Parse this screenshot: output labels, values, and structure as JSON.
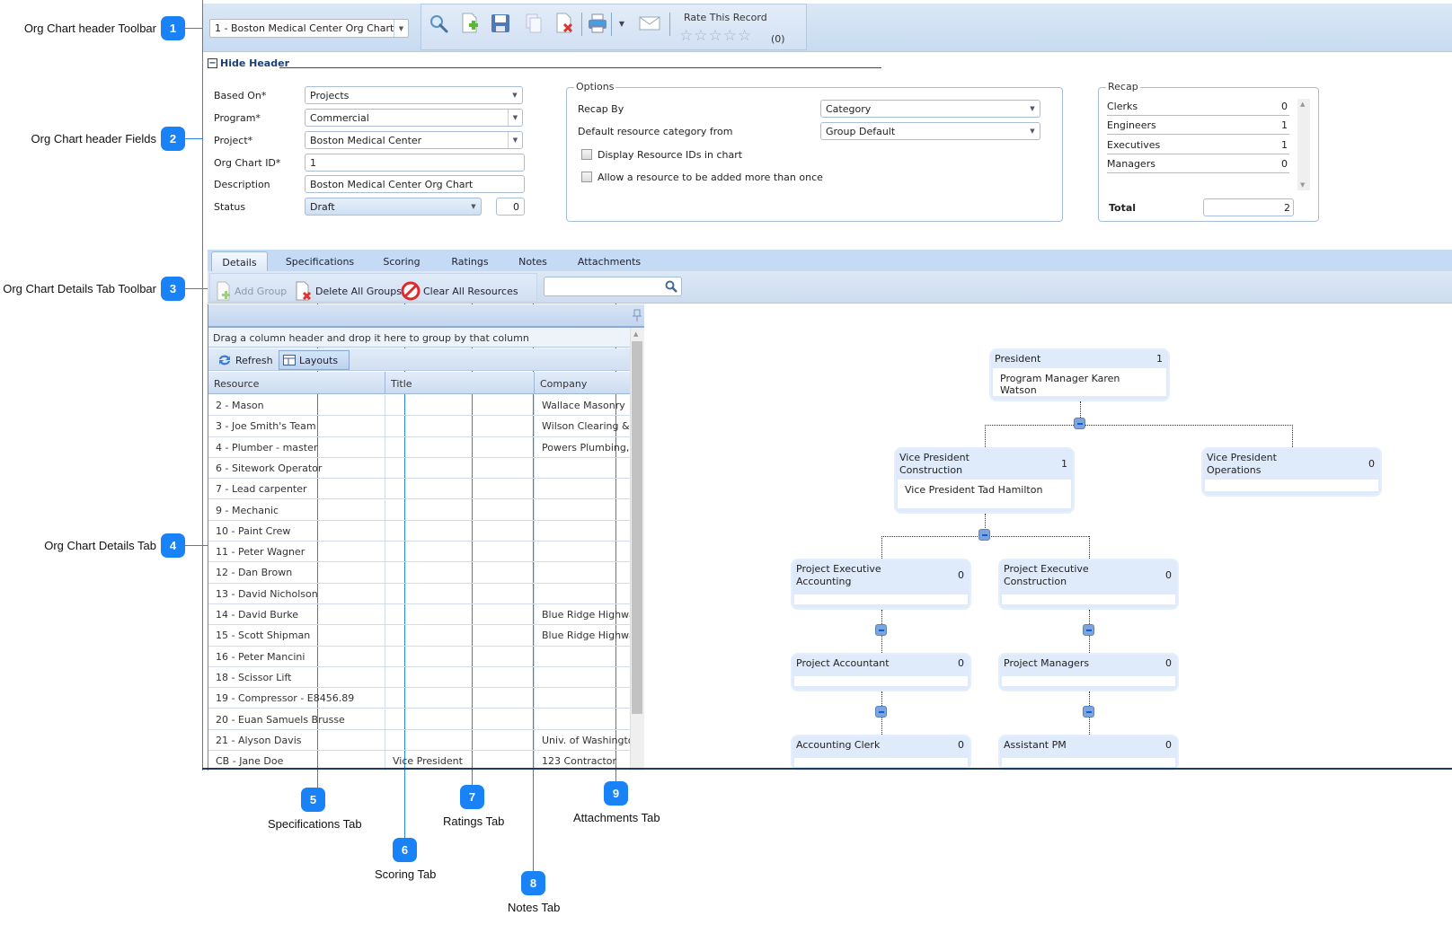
{
  "callouts": [
    {
      "num": "1",
      "label": "Org Chart header Toolbar"
    },
    {
      "num": "2",
      "label": "Org Chart header Fields"
    },
    {
      "num": "3",
      "label": "Org Chart Details Tab Toolbar"
    },
    {
      "num": "4",
      "label": "Org Chart Details Tab"
    },
    {
      "num": "5",
      "label": "Specifications Tab"
    },
    {
      "num": "6",
      "label": "Scoring Tab"
    },
    {
      "num": "7",
      "label": "Ratings Tab"
    },
    {
      "num": "8",
      "label": "Notes Tab"
    },
    {
      "num": "9",
      "label": "Attachments Tab"
    }
  ],
  "toolbar": {
    "record_select": "1 -  Boston Medical Center Org Chart",
    "icons": [
      "search-icon",
      "new-record-icon",
      "save-icon",
      "copy-icon",
      "delete-icon",
      "print-icon",
      "print-dropdown-icon",
      "email-icon"
    ],
    "rate_title": "Rate This Record",
    "rating": {
      "value": 0,
      "max": 5
    },
    "rate_count": "(0)"
  },
  "hide_header": "Hide Header",
  "fields": {
    "based_on": {
      "label": "Based On*",
      "value": "Projects"
    },
    "program": {
      "label": "Program*",
      "value": "Commercial"
    },
    "project": {
      "label": "Project*",
      "value": "Boston Medical Center"
    },
    "org_chart_id": {
      "label": "Org Chart ID*",
      "value": "1"
    },
    "description": {
      "label": "Description",
      "value": "Boston Medical Center Org Chart"
    },
    "status": {
      "label": "Status",
      "value": "Draft",
      "number": "0"
    }
  },
  "options": {
    "title": "Options",
    "recap_by": {
      "label": "Recap By",
      "value": "Category"
    },
    "default_category": {
      "label": "Default resource category from",
      "value": "Group Default"
    },
    "display_ids": {
      "label": "Display Resource IDs in chart",
      "checked": false
    },
    "allow_multiple": {
      "label": "Allow a resource to be added more than once",
      "checked": false
    }
  },
  "recap": {
    "title": "Recap",
    "rows": [
      {
        "label": "Clerks",
        "value": "0"
      },
      {
        "label": "Engineers",
        "value": "1"
      },
      {
        "label": "Executives",
        "value": "1"
      },
      {
        "label": "Managers",
        "value": "0"
      }
    ],
    "total_label": "Total",
    "total_value": "2"
  },
  "tabs": [
    {
      "label": "Details",
      "active": true
    },
    {
      "label": "Specifications"
    },
    {
      "label": "Scoring"
    },
    {
      "label": "Ratings"
    },
    {
      "label": "Notes"
    },
    {
      "label": "Attachments"
    }
  ],
  "tab_toolbar": {
    "add_group": "Add Group",
    "delete_all_groups": "Delete All Groups",
    "clear_all_resources": "Clear All Resources",
    "search_placeholder": ""
  },
  "grid": {
    "group_panel_text": "Drag a column header and drop it here to group by that column",
    "refresh": "Refresh",
    "layouts": "Layouts",
    "columns": [
      "Resource",
      "Title",
      "Company"
    ],
    "rows": [
      [
        "2 - Mason",
        "",
        "Wallace Masonry"
      ],
      [
        "3 - Joe Smith's Team",
        "",
        "Wilson Clearing & D"
      ],
      [
        "4 - Plumber - master",
        "",
        "Powers Plumbing, In"
      ],
      [
        "6 - Sitework Operator",
        "",
        ""
      ],
      [
        "7 - Lead carpenter",
        "",
        ""
      ],
      [
        "9 - Mechanic",
        "",
        ""
      ],
      [
        "10 - Paint Crew",
        "",
        ""
      ],
      [
        "11 - Peter Wagner",
        "",
        ""
      ],
      [
        "12 - Dan Brown",
        "",
        ""
      ],
      [
        "13 - David Nicholson",
        "",
        ""
      ],
      [
        "14 - David Burke",
        "",
        "Blue Ridge Highway"
      ],
      [
        "15 - Scott Shipman",
        "",
        "Blue Ridge Highway"
      ],
      [
        "16 - Peter Mancini",
        "",
        ""
      ],
      [
        "18 - Scissor Lift",
        "",
        ""
      ],
      [
        "19 - Compressor - E8456.89",
        "",
        ""
      ],
      [
        "20 - Euan Samuels Brusse",
        "",
        ""
      ],
      [
        "21 - Alyson Davis",
        "",
        "Univ. of Washington"
      ],
      [
        "CB - Jane Doe",
        "Vice President",
        "123 Contractor"
      ]
    ]
  },
  "org_chart": {
    "nodes": [
      {
        "id": "president",
        "title": "President",
        "count": "1",
        "member": "Program Manager Karen Watson"
      },
      {
        "id": "vp-construction",
        "title": "Vice President\nConstruction",
        "count": "1",
        "member": "Vice President Tad Hamilton"
      },
      {
        "id": "vp-operations",
        "title": "Vice President\nOperations",
        "count": "0",
        "member": ""
      },
      {
        "id": "pe-accounting",
        "title": "Project Executive\nAccounting",
        "count": "0",
        "member": ""
      },
      {
        "id": "pe-construction",
        "title": "Project Executive\nConstruction",
        "count": "0",
        "member": ""
      },
      {
        "id": "project-accountant",
        "title": "Project Accountant",
        "count": "0",
        "member": ""
      },
      {
        "id": "project-managers",
        "title": "Project Managers",
        "count": "0",
        "member": ""
      },
      {
        "id": "accounting-clerk",
        "title": "Accounting Clerk",
        "count": "0",
        "member": ""
      },
      {
        "id": "assistant-pm",
        "title": "Assistant PM",
        "count": "0",
        "member": ""
      }
    ]
  }
}
